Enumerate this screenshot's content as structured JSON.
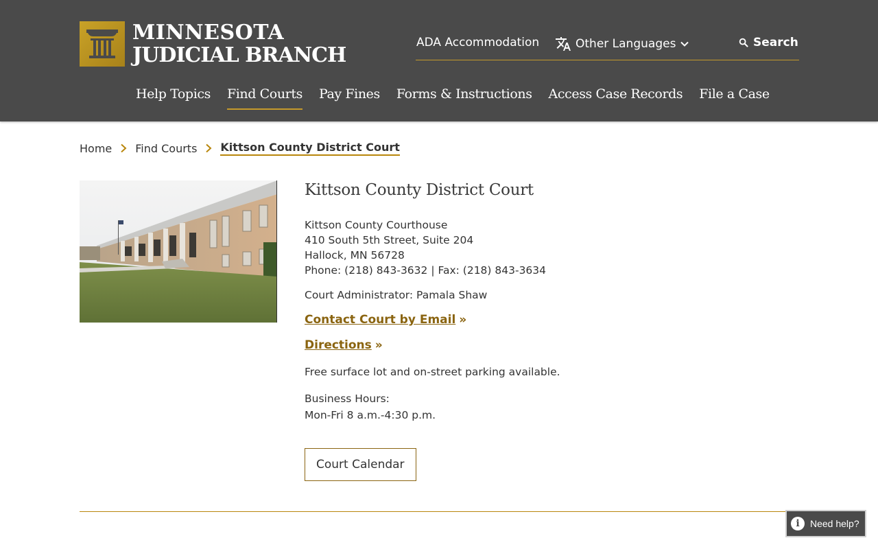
{
  "colors": {
    "header_bg": "#4a4a4a",
    "accent_gold": "#c59a2b",
    "link_gold": "#8a6410",
    "text": "#333333"
  },
  "header": {
    "logo_line1": "MINNESOTA",
    "logo_line2": "JUDICIAL BRANCH",
    "ada_label": "ADA Accommodation",
    "languages_label": "Other Languages",
    "search_label": "Search",
    "nav": [
      {
        "label": "Help Topics",
        "active": false
      },
      {
        "label": "Find Courts",
        "active": true
      },
      {
        "label": "Pay Fines",
        "active": false
      },
      {
        "label": "Forms & Instructions",
        "active": false
      },
      {
        "label": "Access Case Records",
        "active": false
      },
      {
        "label": "File a Case",
        "active": false
      }
    ]
  },
  "breadcrumb": [
    "Home",
    "Find Courts",
    "Kittson County District Court"
  ],
  "court": {
    "title": "Kittson County District Court",
    "building": "Kittson County Courthouse",
    "street": "410 South 5th Street, Suite 204",
    "city": "Hallock, MN 56728",
    "phone_fax": "Phone: (218) 843-3632 | Fax: (218) 843-3634",
    "administrator": "Court Administrator: Pamala Shaw",
    "email_link": "Contact Court by Email",
    "directions_link": "Directions",
    "link_suffix": "»",
    "parking": "Free surface lot and on-street parking available.",
    "hours_label": "Business Hours:",
    "hours": "Mon-Fri 8 a.m.-4:30 p.m.",
    "calendar_button": "Court Calendar"
  },
  "help_widget": {
    "label": "Need help?",
    "icon": "info-icon"
  }
}
